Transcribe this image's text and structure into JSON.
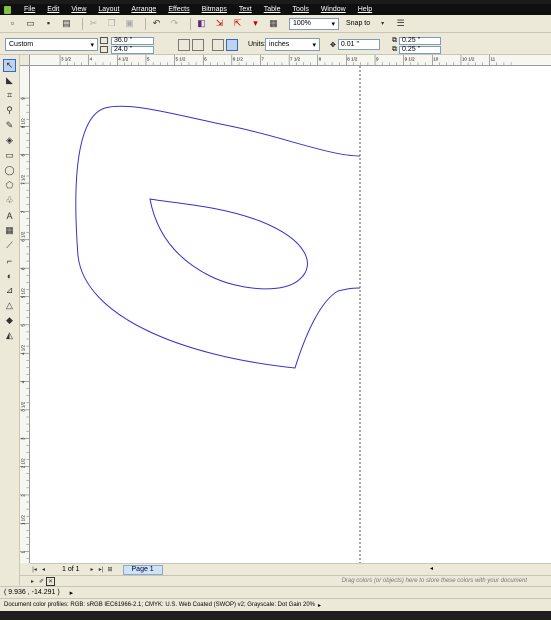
{
  "menu": {
    "items": [
      "File",
      "Edit",
      "View",
      "Layout",
      "Arrange",
      "Effects",
      "Bitmaps",
      "Text",
      "Table",
      "Tools",
      "Window",
      "Help"
    ]
  },
  "toolbar": {
    "zoom": "100%",
    "snap_to": "Snap to",
    "icons": [
      "new-icon",
      "open-icon",
      "save-icon",
      "print-icon",
      "cut-icon",
      "copy-icon",
      "paste-icon",
      "undo-icon",
      "redo-icon",
      "search-icon",
      "import-icon",
      "export-icon",
      "application-launcher-icon",
      "welcome-screen-icon",
      "options-icon"
    ]
  },
  "property_bar": {
    "page_size": "Custom",
    "width": "36.0 \"",
    "height": "24.0 \"",
    "units_label": "Units:",
    "units": "inches",
    "nudge": "0.01 \"",
    "dup_x": "0.25 \"",
    "dup_y": "0.25 \""
  },
  "rulers": {
    "horizontal_labels": [
      "3 1/2",
      "4",
      "4 1/2",
      "5",
      "5 1/2",
      "6",
      "6 1/2",
      "7",
      "7 1/2",
      "8",
      "8 1/2",
      "9",
      "9 1/2",
      "10",
      "10 1/2",
      "11"
    ],
    "vertical_labels": [
      "9",
      "8 1/2",
      "8",
      "7 1/2",
      "7",
      "6 1/2",
      "6",
      "5 1/2",
      "5",
      "4 1/2",
      "4",
      "3 1/2",
      "3",
      "2 1/2",
      "2",
      "1 1/2",
      "1",
      "1/2"
    ]
  },
  "page_nav": {
    "count": "1 of 1",
    "page_tab": "Page 1"
  },
  "palette": {
    "hint": "Drag colors (or objects) here to store these colors with your document"
  },
  "status": {
    "coords": "( 9.936 , -14.291 )",
    "color_profiles": "Document color profiles: RGB: sRGB IEC61966-2.1; CMYK: U.S. Web Coated (SWOP) v2; Grayscale: Dot Gain 20%"
  }
}
